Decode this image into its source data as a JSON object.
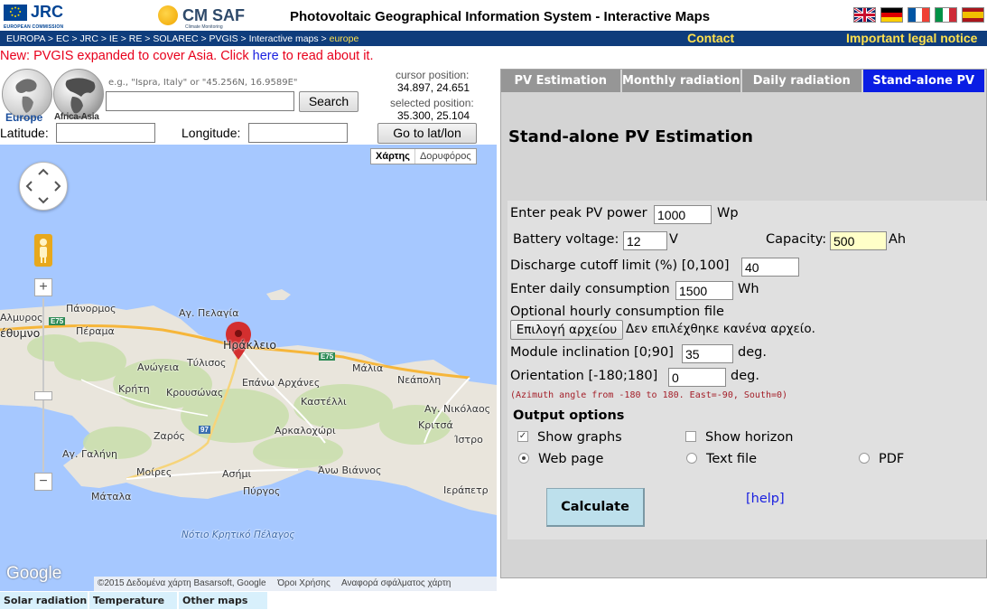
{
  "header": {
    "jrc_label": "JRC",
    "jrc_sub": "EUROPEAN COMMISSION",
    "cmsaf_label": "CM SAF",
    "cmsaf_sub": "Climate Monitoring",
    "title": "Photovoltaic Geographical Information System - Interactive Maps",
    "languages": [
      "english-flag-icon",
      "german-flag-icon",
      "french-flag-icon",
      "italian-flag-icon",
      "spanish-flag-icon"
    ]
  },
  "nav": {
    "breadcrumb": [
      "EUROPA",
      "EC",
      "JRC",
      "IE",
      "RE",
      "SOLAREC",
      "PVGIS",
      "Interactive maps"
    ],
    "breadcrumb_separator": " > ",
    "breadcrumb_current": "europe",
    "contact": "Contact",
    "legal": "Important legal notice"
  },
  "news": {
    "prefix": "New: PVGIS expanded to cover Asia. Click ",
    "link": "here",
    "suffix": " to read about it."
  },
  "region": {
    "europe": "Europe",
    "asia": "Africa-Asia"
  },
  "search": {
    "hint": "e.g., \"Ispra, Italy\" or \"45.256N, 16.9589E\"",
    "value": "",
    "button": "Search"
  },
  "position": {
    "cursor_label": "cursor position:",
    "cursor_value": "34.897, 24.651",
    "selected_label": "selected position:",
    "selected_value": "35.300, 25.104"
  },
  "coords": {
    "lat_label": "Latitude:",
    "lat_value": "",
    "lon_label": "Longitude:",
    "lon_value": "",
    "goto_button": "Go to lat/lon"
  },
  "map": {
    "type_map": "Χάρτης",
    "type_satellite": "Δορυφόρος",
    "zoom_in": "+",
    "zoom_out": "−",
    "google": "Google",
    "attribution": [
      "©2015 Δεδομένα χάρτη Basarsoft, Google",
      "Όροι Χρήσης",
      "Αναφορά σφάλματος χάρτη"
    ],
    "places": {
      "panormos": "Πάνορμος",
      "perama": "Πέραμα",
      "almyros": "Αλμυρος",
      "rethymno": "έθυμνο",
      "ag_pelagia": "Αγ. Πελαγία",
      "irakleio": "Ηράκλειο",
      "anogeia": "Ανώγεια",
      "tylisos": "Τύλισος",
      "malia": "Μάλια",
      "kriti": "Κρήτη",
      "krousonas": "Κρουσώνας",
      "epano_arxanes": "Επάνω Αρχάνες",
      "kastelli": "Καστέλλι",
      "neapoli": "Νεάπολη",
      "ag_nikolaos": "Αγ. Νικόλαος",
      "kritsa": "Κριτσά",
      "zaros": "Ζαρός",
      "arkalochori": "Αρκαλοχώρι",
      "ag_galini": "Αγ. Γαλήνη",
      "moires": "Μοίρες",
      "asimi": "Ασήμι",
      "ano_viannos": "Άνω Βιάννος",
      "pyrgos": "Πύργος",
      "matala": "Μάταλα",
      "ierapetra": "Ιεράπετρ",
      "istro": "Ίστρο",
      "sea": "Νότιο Κρητικό Πέλαγος"
    },
    "roads": {
      "e75_west": "E75",
      "e75_east": "E75",
      "r97": "97"
    }
  },
  "map_tabs": [
    "Solar radiation",
    "Temperature",
    "Other maps"
  ],
  "tabs": [
    {
      "label": "PV Estimation",
      "active": false
    },
    {
      "label": "Monthly radiation",
      "active": false
    },
    {
      "label": "Daily radiation",
      "active": false
    },
    {
      "label": "Stand-alone PV",
      "active": true
    }
  ],
  "panel": {
    "title": "Stand-alone PV Estimation",
    "peak_power_label": "Enter peak PV power",
    "peak_power_value": "1000",
    "peak_power_unit": "Wp",
    "battery_voltage_label": "Battery voltage:",
    "battery_voltage_value": "12",
    "battery_voltage_unit": "V",
    "capacity_label": "Capacity:",
    "capacity_value": "500",
    "capacity_unit": "Ah",
    "discharge_label": "Discharge cutoff limit (%) [0,100]",
    "discharge_value": "40",
    "consumption_label": "Enter daily consumption",
    "consumption_value": "1500",
    "consumption_unit": "Wh",
    "hourly_label": "Optional hourly consumption file",
    "file_button": "Επιλογή αρχείου",
    "file_status": "Δεν επιλέχθηκε κανένα αρχείο.",
    "inclination_label": "Module inclination [0;90]",
    "inclination_value": "35",
    "inclination_unit": "deg.",
    "orientation_label": "Orientation [-180;180]",
    "orientation_value": "0",
    "orientation_unit": "deg.",
    "azimuth_note": "(Azimuth angle from -180 to 180. East=-90, South=0)",
    "output_heading": "Output options",
    "show_graphs": {
      "label": "Show graphs",
      "checked": true
    },
    "show_horizon": {
      "label": "Show horizon",
      "checked": false
    },
    "format": [
      {
        "label": "Web page",
        "selected": true
      },
      {
        "label": "Text file",
        "selected": false
      },
      {
        "label": "PDF",
        "selected": false
      }
    ],
    "calculate": "Calculate",
    "help": "[help]"
  },
  "colors": {
    "nav_bg": "#0f3d7c",
    "nav_highlight": "#ffe14d",
    "active_tab": "#0a1de4",
    "inactive_tab": "#969696",
    "news": "#e8001c",
    "sea": "#a6c8ff",
    "land": "#e9e5dc",
    "marker": "#d32f2f"
  }
}
